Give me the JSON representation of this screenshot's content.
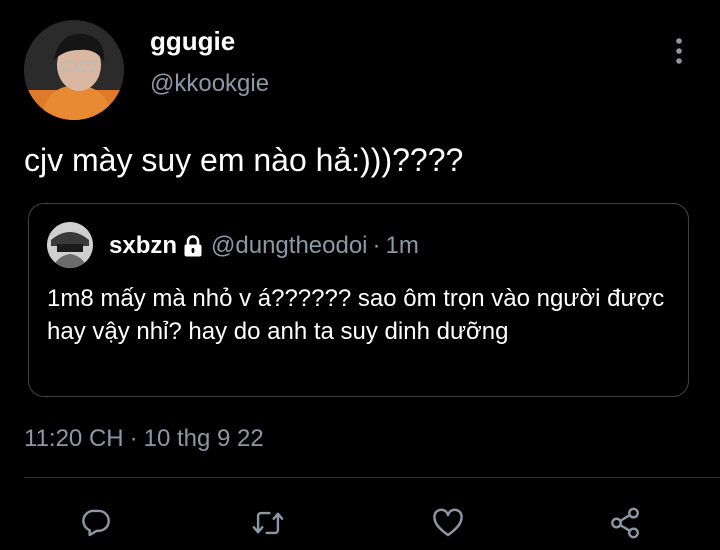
{
  "tweet": {
    "display_name": "ggugie",
    "handle": "@kkookgie",
    "text": "cjv mày suy em nào hả:)))????",
    "timestamp": "11:20 CH",
    "date": "10 thg 9 22",
    "separator": "·"
  },
  "quoted_tweet": {
    "display_name": "sxbzn",
    "handle": "@dungtheodoi",
    "separator": "·",
    "time": "1m",
    "text": "1m8 mấy mà nhỏ v á?????? sao ôm trọn vào người được hay vậy nhỉ? hay do anh ta suy dinh dưỡng"
  },
  "icons": {
    "more": "more-vertical-icon",
    "lock": "lock-icon",
    "reply": "reply-icon",
    "retweet": "retweet-icon",
    "like": "like-icon",
    "share": "share-icon"
  },
  "colors": {
    "background": "#000000",
    "primary_text": "#ffffff",
    "secondary_text": "#8b98a5",
    "border": "#3e4144",
    "icon": "#8b98a5"
  }
}
